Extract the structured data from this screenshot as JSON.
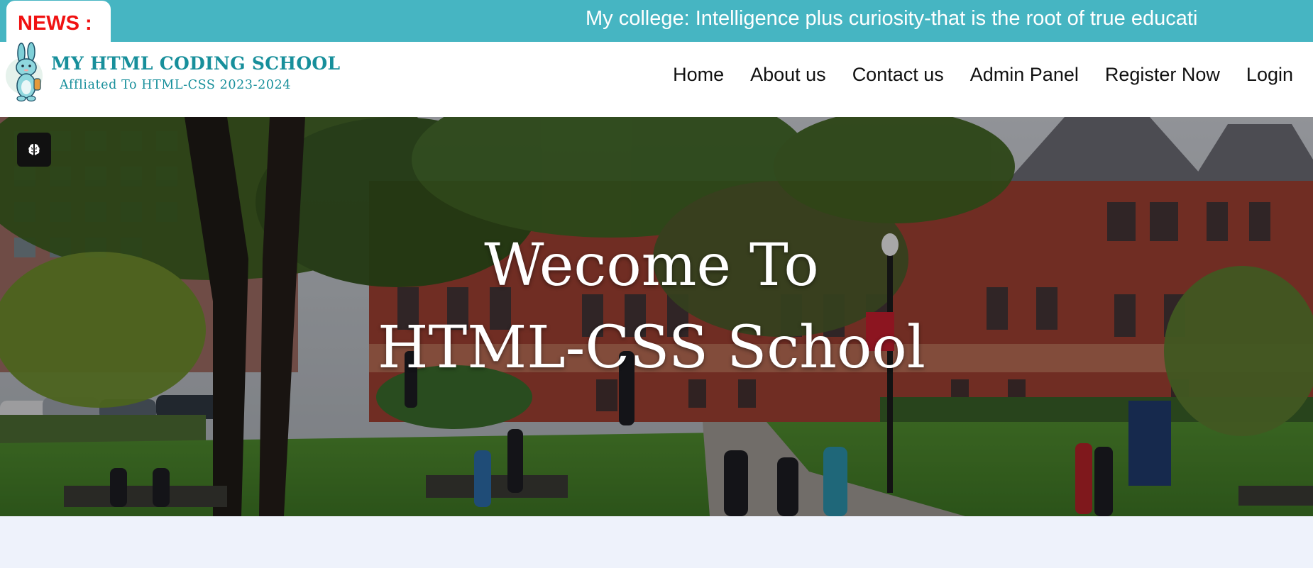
{
  "news": {
    "label": "NEWS :",
    "ticker_text": "My college: Intelligence plus curiosity-that is the root of true educati"
  },
  "brand": {
    "title": "MY HTML CODING SCHOOL",
    "subtitle": "Affliated To HTML-CSS 2023-2024",
    "logo_icon": "bunny-mascot-icon",
    "color": "#178f9b"
  },
  "nav": {
    "items": [
      {
        "label": "Home"
      },
      {
        "label": "About us"
      },
      {
        "label": "Contact us"
      },
      {
        "label": "Admin Panel"
      },
      {
        "label": "Register Now"
      },
      {
        "label": "Login"
      }
    ]
  },
  "hero": {
    "line1": "Wecome To",
    "line2": "HTML-CSS School",
    "accessibility_icon": "brain-icon"
  },
  "colors": {
    "news_bar": "#46b5c2",
    "news_label": "#f01111",
    "page_bg": "#eef2fb"
  }
}
